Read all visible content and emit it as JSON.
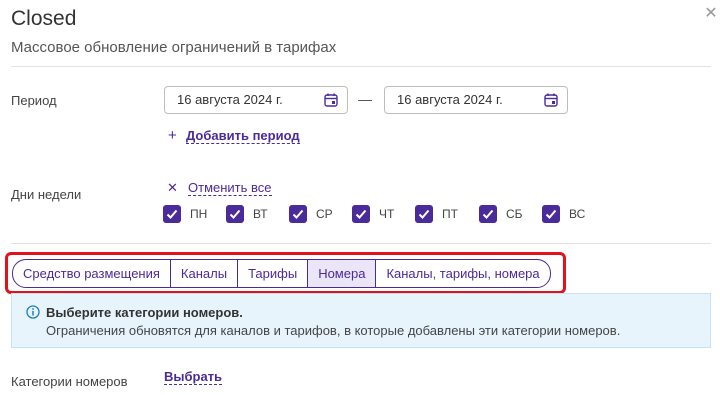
{
  "modal": {
    "title": "Closed",
    "subtitle": "Массовое обновление ограничений в тарифах"
  },
  "period": {
    "label": "Период",
    "date_from": "16 августа 2024 г.",
    "date_to": "16 августа 2024 г.",
    "add_period": "Добавить период"
  },
  "weekdays": {
    "label": "Дни недели",
    "cancel_all": "Отменить все",
    "days": [
      {
        "label": "ПН",
        "checked": true
      },
      {
        "label": "ВТ",
        "checked": true
      },
      {
        "label": "СР",
        "checked": true
      },
      {
        "label": "ЧТ",
        "checked": true
      },
      {
        "label": "ПТ",
        "checked": true
      },
      {
        "label": "СБ",
        "checked": true
      },
      {
        "label": "ВС",
        "checked": true
      }
    ]
  },
  "tabs": {
    "items": [
      {
        "label": "Средство размещения",
        "active": false
      },
      {
        "label": "Каналы",
        "active": false
      },
      {
        "label": "Тарифы",
        "active": false
      },
      {
        "label": "Номера",
        "active": true
      },
      {
        "label": "Каналы, тарифы, номера",
        "active": false
      }
    ]
  },
  "info": {
    "heading": "Выберите категории номеров.",
    "text": "Ограничения обновятся для каналов и тарифов, в которые добавлены эти категории номеров."
  },
  "room_categories": {
    "label": "Категории номеров",
    "select": "Выбрать"
  },
  "colors": {
    "accent": "#4b2a9a",
    "highlight": "#e3111b",
    "info_bg": "#e8f4fc"
  }
}
